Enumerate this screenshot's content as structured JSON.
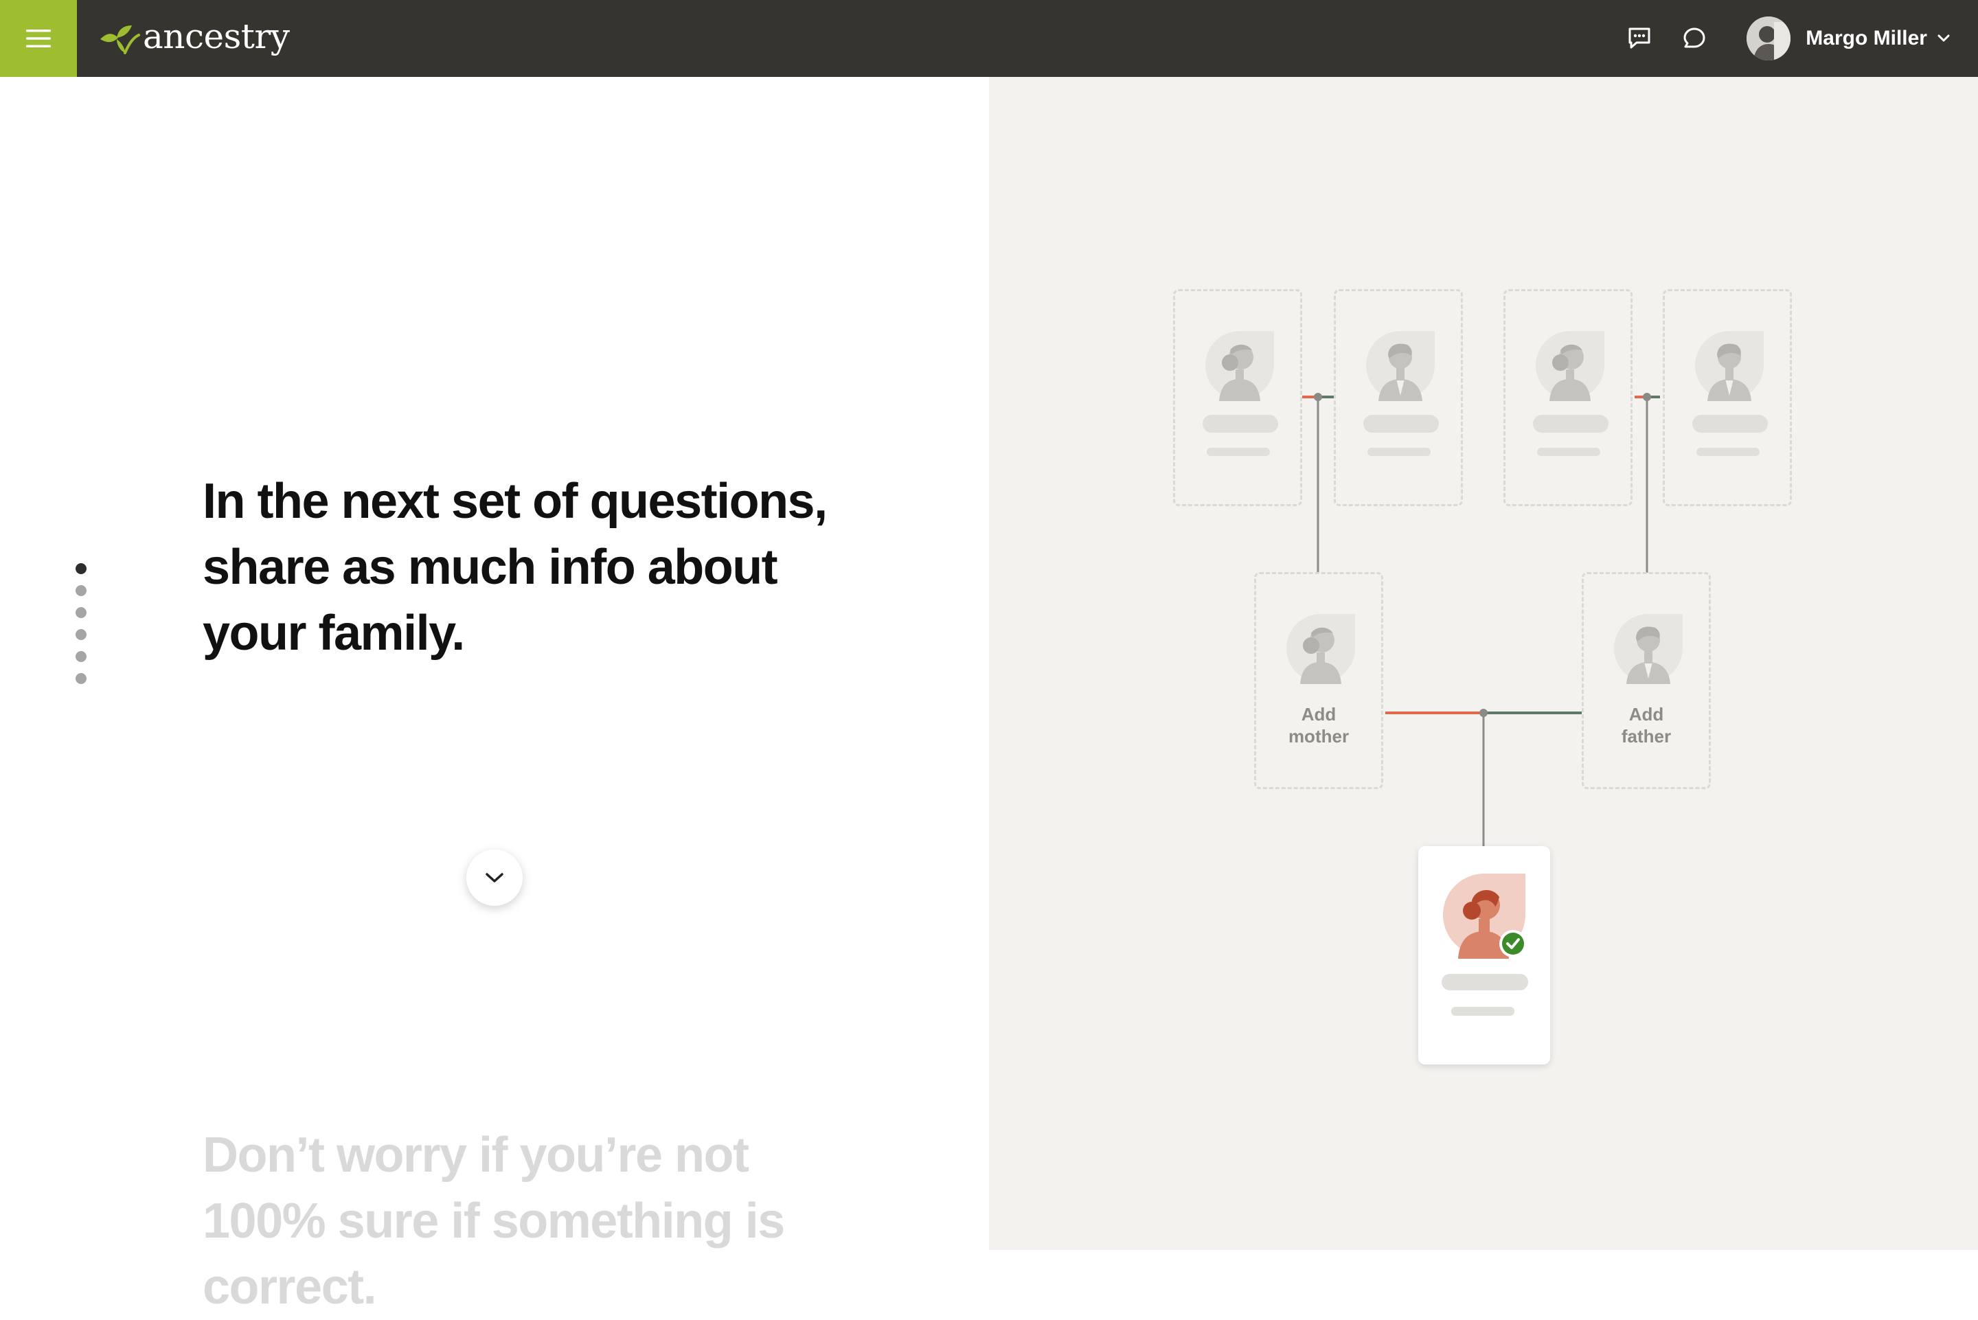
{
  "app": {
    "brand": "ancestry",
    "icons": {
      "menu": "hamburger-menu-icon",
      "logo": "leaf-logo-icon",
      "messages": "message-icon",
      "chat": "chat-bubble-icon",
      "avatar": "user-avatar",
      "chevron": "chevron-down-icon"
    },
    "colors": {
      "header_bg": "#36342f",
      "menu_accent": "#9cbe30",
      "panel_bg": "#f4f2ef",
      "mother_line": "#e0694a",
      "father_line": "#5e7a66",
      "check": "#3b8b2b"
    }
  },
  "user": {
    "name": "Margo Miller"
  },
  "progress": {
    "total_steps": 6,
    "current_step": 1
  },
  "intro": {
    "headline": "In the next set of questions, share as much info about your family.",
    "faded_text": "Don’t worry if you’re not 100% sure if something is correct."
  },
  "tree": {
    "mother_label": "Add mother",
    "father_label": "Add father",
    "self_verified": true
  }
}
